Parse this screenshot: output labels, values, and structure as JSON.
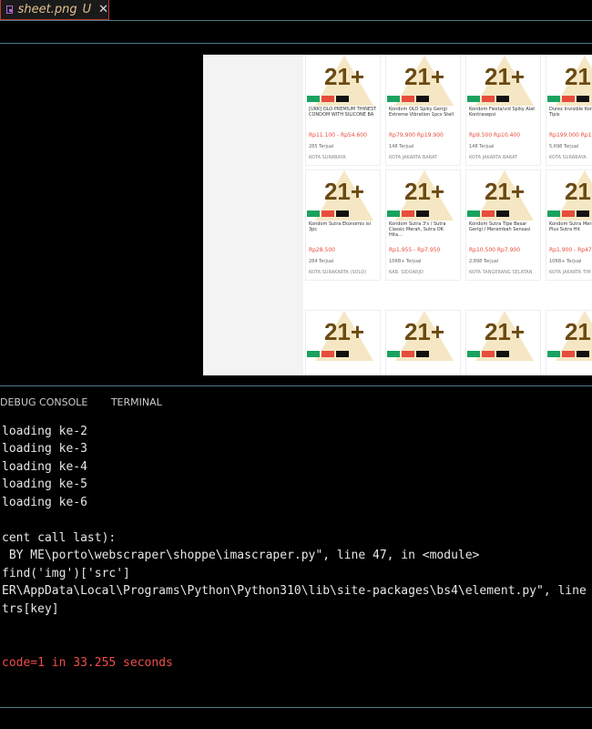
{
  "tab": {
    "filename": "sheet.png",
    "status": "U",
    "close": "✕"
  },
  "products": [
    {
      "title": "[UKK] OLO PREMIUM THINEST CONDOM WITH SILICONE BA",
      "price": "Rp11.100 - Rp54.600",
      "sold": "285 Terjual",
      "location": "KOTA SURABAYA"
    },
    {
      "title": "Kondom OLO Spiky Gerigi Extreme Vibration 1pcs Stell",
      "price": "Rp79.900  Rp19.900",
      "sold": "148 Terjual",
      "location": "KOTA JAKARTA BARAT"
    },
    {
      "title": "Kondom Fiesta/vid Spiky Alat Kontrasepsi",
      "price": "Rp9.500  Rp10.400",
      "sold": "148 Terjual",
      "location": "KOTA JAKARTA BARAT"
    },
    {
      "title": "Durex Invisible Kondom Extra Tipis",
      "price": "Rp199.000 Rp17",
      "sold": "5,698 Terjual",
      "location": "KOTA SURABAYA"
    },
    {
      "title": "Kondom Sutra Ekonomis isi 3pc",
      "price": "Rp28.500",
      "sold": "284 Terjual",
      "location": "KOTA SURAKARTA (SOLO)"
    },
    {
      "title": "Kondom Sutra 3's / Sutra Classic Merah, Sutra OK Hita...",
      "price": "Rp1.955 - Rp7.950",
      "sold": "10RB+ Terjual",
      "location": "KAB. SIDOARJO"
    },
    {
      "title": "Kondom Sutra Tipe Besar Gerigi / Merambah Sensasi",
      "price": "Rp10.500  Rp7.900",
      "sold": "2,898 Terjual",
      "location": "KOTA TANGERANG SELATAN"
    },
    {
      "title": "Kondom Sutra Merah Sutra Plus Sutra Hit",
      "price": "Rp1.900 - Rp47",
      "sold": "10RB+ Terjual",
      "location": "KOTA JAKARTA TIM"
    },
    {
      "title": "",
      "price": "",
      "sold": "",
      "location": ""
    },
    {
      "title": "",
      "price": "",
      "sold": "",
      "location": ""
    },
    {
      "title": "",
      "price": "",
      "sold": "",
      "location": ""
    },
    {
      "title": "",
      "price": "",
      "sold": "",
      "location": ""
    }
  ],
  "product_logo_text": "21+",
  "panel_tabs": [
    "DEBUG CONSOLE",
    "TERMINAL"
  ],
  "terminal_lines": [
    "loading ke-2",
    "loading ke-3",
    "loading ke-4",
    "loading ke-5",
    "loading ke-6",
    "",
    "cent call last):",
    " BY ME\\porto\\webscraper\\shoppe\\imascraper.py\", line 47, in <module>",
    "find('img')['src']",
    "ER\\AppData\\Local\\Programs\\Python\\Python310\\lib\\site-packages\\bs4\\element.py\", line",
    "trs[key]"
  ],
  "exit_code_text": "code=1",
  "exit_time_text": " in 33.255 seconds",
  "colors": {
    "accent_tab_border": "#c0392b",
    "filename": "#e2c08d",
    "divider": "#4a7a8c",
    "error": "#f14c4c"
  }
}
